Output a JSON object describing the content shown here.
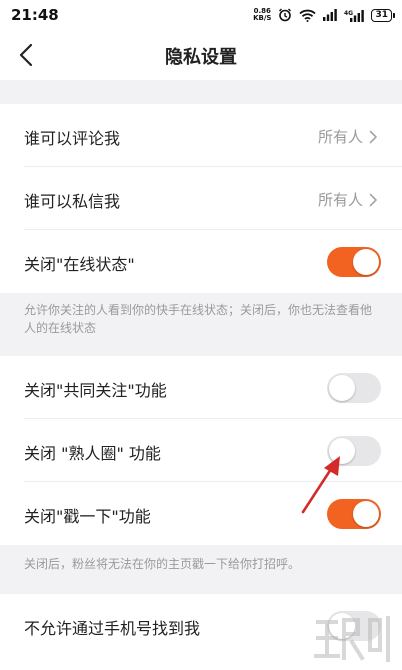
{
  "status_bar": {
    "time": "21:48",
    "net_speed_value": "0.86",
    "net_speed_unit": "KB/S",
    "network_type": "4G",
    "battery": "31"
  },
  "header": {
    "title": "隐私设置"
  },
  "settings": [
    {
      "label": "谁可以评论我",
      "value": "所有人"
    },
    {
      "label": "谁可以私信我",
      "value": "所有人"
    },
    {
      "label": "关闭\"在线状态\"",
      "toggle": true
    },
    {
      "label": "关闭\"共同关注\"功能",
      "toggle": false
    },
    {
      "label": "关闭 \"熟人圈\" 功能",
      "toggle": false
    },
    {
      "label": "关闭\"戳一下\"功能",
      "toggle": true
    },
    {
      "label": "不允许通过手机号找到我",
      "toggle": false
    }
  ],
  "notes": {
    "online_status": "允许你关注的人看到你的快手在线状态；关闭后，你也无法查看他人的在线状态",
    "poke": "关闭后，粉丝将无法在你的主页戳一下给你打招呼。"
  },
  "colors": {
    "accent": "#f26321",
    "toggle_off": "#e6e6e9",
    "arrow": "#d42a2a"
  },
  "icons": {
    "back": "back-chevron-icon",
    "alarm": "alarm-clock-icon",
    "wifi": "wifi-icon",
    "signal": "signal-icon",
    "chevron": "chevron-right-icon",
    "annotation": "red-arrow-icon"
  }
}
